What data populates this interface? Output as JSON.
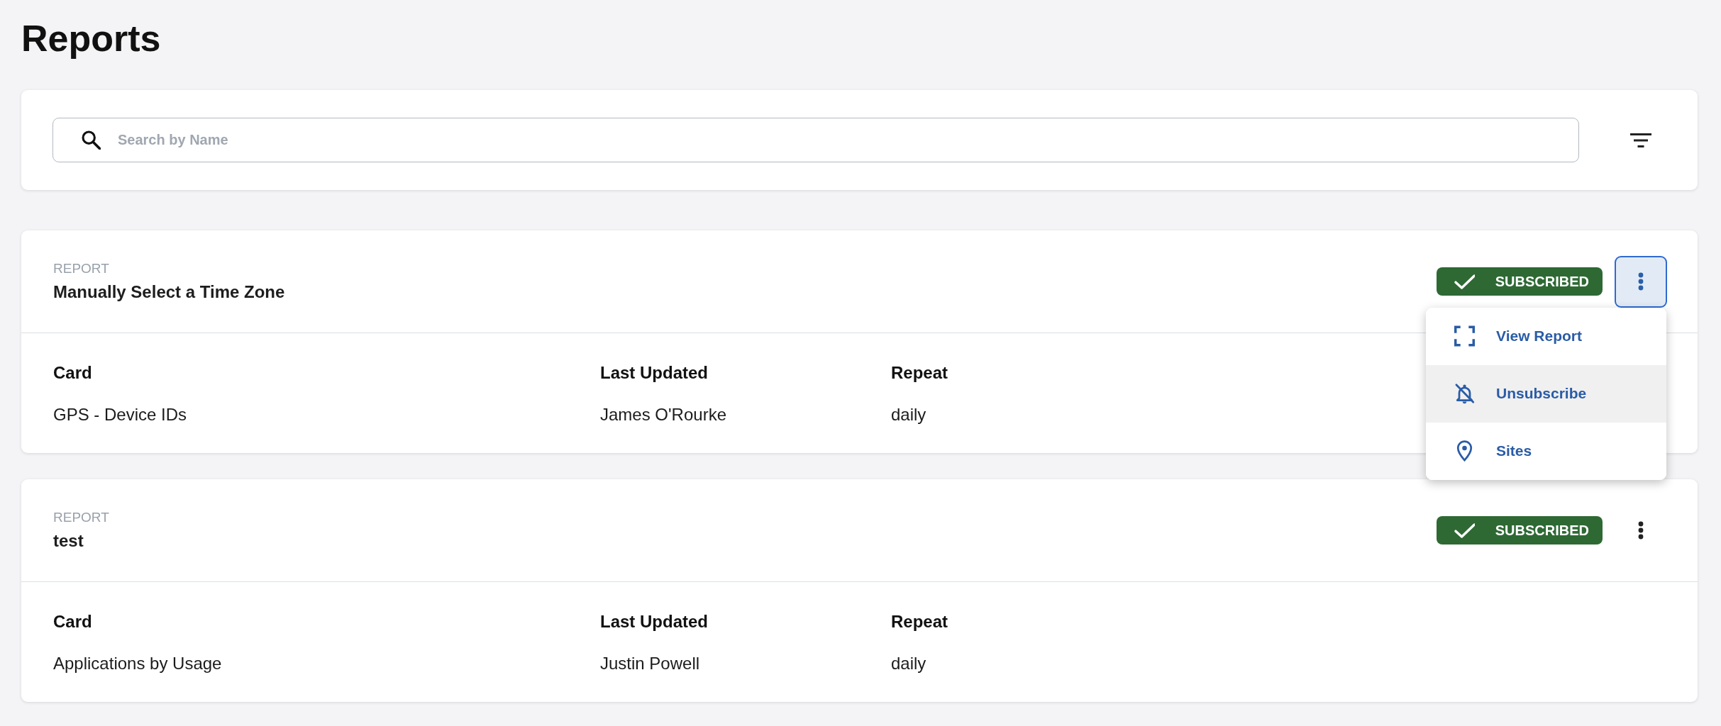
{
  "page": {
    "title": "Reports"
  },
  "search": {
    "placeholder": "Search by Name"
  },
  "reports": [
    {
      "label": "REPORT",
      "name": "Manually Select a Time Zone",
      "badge": {
        "kind": "subscribed",
        "text": "SUBSCRIBED"
      },
      "menu_expanded": true,
      "menu_items": [
        {
          "kind": "view",
          "label": "View Report",
          "selected": false
        },
        {
          "kind": "unsubscribe",
          "label": "Unsubscribe",
          "selected": true
        },
        {
          "kind": "sites",
          "label": "Sites",
          "selected": false
        }
      ],
      "fields": [
        {
          "label": "Card",
          "value": "GPS - Device IDs"
        },
        {
          "label": "Last Updated",
          "value": "James O'Rourke"
        },
        {
          "label": "Repeat",
          "value": "daily"
        }
      ]
    },
    {
      "label": "REPORT",
      "name": "test",
      "badge": {
        "kind": "subscribed",
        "text": "SUBSCRIBED"
      },
      "menu_expanded": false,
      "fields": [
        {
          "label": "Card",
          "value": "Applications by Usage"
        },
        {
          "label": "Last Updated",
          "value": "Justin Powell"
        },
        {
          "label": "Repeat",
          "value": "daily"
        }
      ]
    }
  ]
}
